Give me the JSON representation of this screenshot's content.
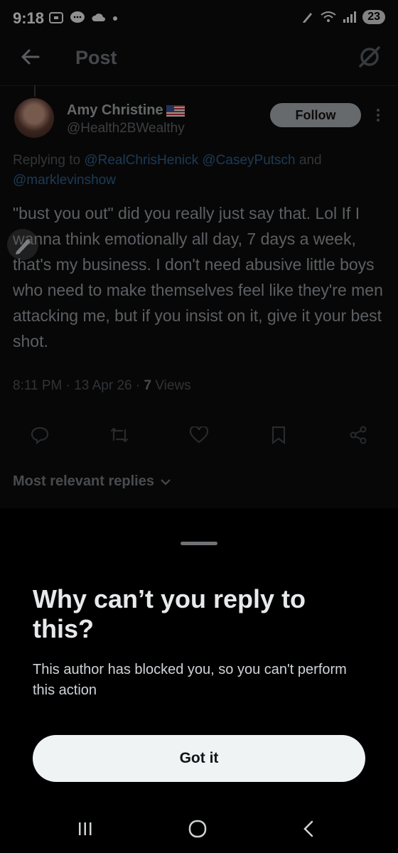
{
  "status_bar": {
    "time": "9:18",
    "battery": "23"
  },
  "header": {
    "title": "Post"
  },
  "post": {
    "author_name": "Amy Christine",
    "author_handle": "@Health2BWealthy",
    "follow_label": "Follow",
    "replying_prefix": "Replying to ",
    "replying_mentions": "@RealChrisHenick @CaseyPutsch",
    "replying_and": " and ",
    "replying_last": "@marklevinshow",
    "text": "\"bust you out\" did you really just say that. Lol  If I wanna think emotionally all day, 7 days a week, that's my business.  I don't need abusive little boys who need to make themselves feel like they're men attacking me, but if you insist on it, give it your best shot.",
    "timestamp": "8:11 PM · 13 Apr 26 · ",
    "views_count": "7",
    "views_label": " Views"
  },
  "replies_filter": {
    "label": "Most relevant replies"
  },
  "sheet": {
    "title": "Why can’t you reply to this?",
    "message": "This author has blocked you, so you can't perform this action",
    "button_label": "Got it"
  },
  "colors": {
    "background": "#000000",
    "mention": "#1d9bf0",
    "button_bg": "#eff3f4"
  }
}
